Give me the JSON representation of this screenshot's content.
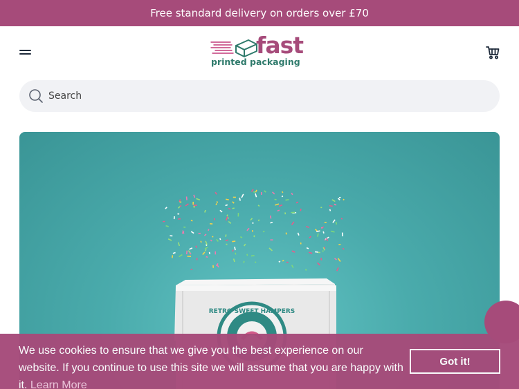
{
  "announcement": {
    "text": "Free standard delivery on orders over £70"
  },
  "header": {
    "logo_main": "fast",
    "logo_sub": "printed packaging"
  },
  "search": {
    "placeholder": "Search"
  },
  "hero": {
    "box_stamp_text": "RETRO SWEET HAMPERS"
  },
  "cookie_banner": {
    "message": "We use cookies to ensure that we give you the best experience on our website. If you continue to use this site we will assume that you are happy with it.",
    "learn_more": "Learn More",
    "accept": "Got it!"
  },
  "colors": {
    "brand": "#a64b7a",
    "logo_green": "#2e7a6b",
    "hero_teal": "#4aabac"
  },
  "icons": [
    "hamburger-menu-icon",
    "cart-icon",
    "search-icon",
    "chat-icon"
  ]
}
